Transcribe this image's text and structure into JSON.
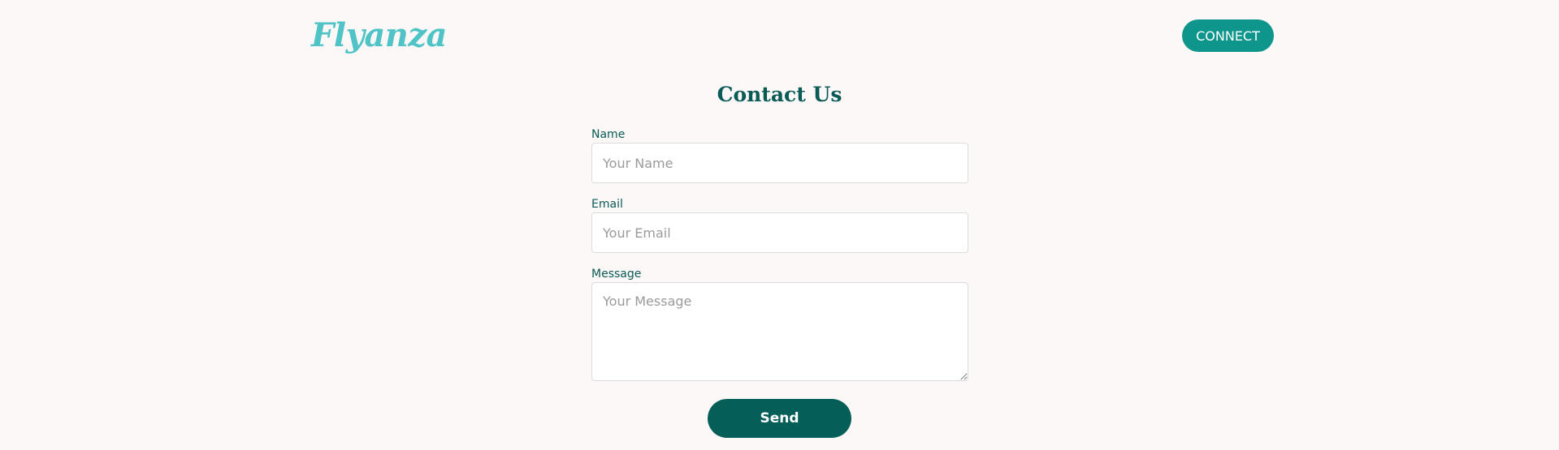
{
  "header": {
    "logo_text": "Flyanza",
    "connect_label": "CONNECT"
  },
  "main": {
    "title": "Contact Us"
  },
  "form": {
    "name": {
      "label": "Name",
      "placeholder": "Your Name",
      "value": ""
    },
    "email": {
      "label": "Email",
      "placeholder": "Your Email",
      "value": ""
    },
    "message": {
      "label": "Message",
      "placeholder": "Your Message",
      "value": ""
    },
    "send_label": "Send"
  },
  "colors": {
    "background": "#fcf8f7",
    "logo": "#4fc3c6",
    "connect_button": "#0e958c",
    "primary_dark": "#065e59",
    "label_text": "#0a5a56"
  }
}
